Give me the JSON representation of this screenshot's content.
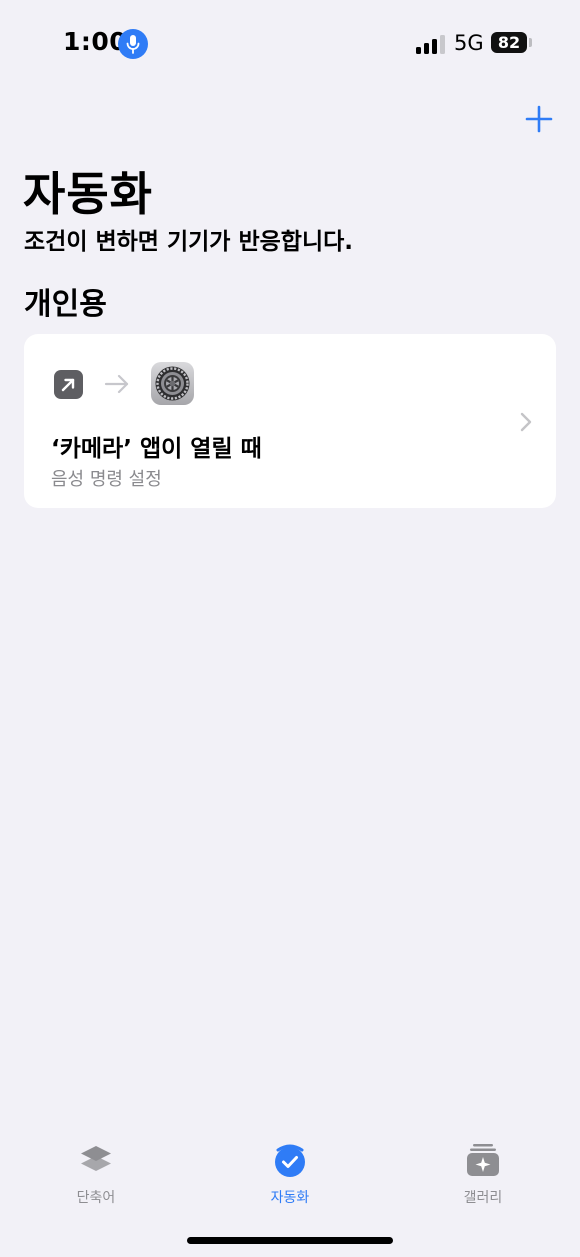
{
  "status_bar": {
    "time": "1:00",
    "network": "5G",
    "battery": "82",
    "mic_icon": "microphone-icon"
  },
  "header": {
    "add_icon": "plus-icon",
    "title": "자동화",
    "subtitle": "조건이 변하면 기기가 반응합니다."
  },
  "section": {
    "title": "개인용"
  },
  "automation": {
    "title": "‘카메라’ 앱이 열릴 때",
    "subtitle": "음성 명령 설정",
    "trigger_icon": "open-app-icon",
    "action_icon": "settings-app-icon"
  },
  "tab_bar": {
    "tabs": [
      {
        "label": "단축어",
        "icon": "shortcuts-layers-icon",
        "active": false
      },
      {
        "label": "자동화",
        "icon": "automation-check-icon",
        "active": true
      },
      {
        "label": "갤러리",
        "icon": "gallery-sparkle-icon",
        "active": false
      }
    ]
  },
  "colors": {
    "accent": "#2F7CF6",
    "background": "#F2F1F7",
    "card": "#FFFFFF",
    "secondary_text": "#8A8A8E"
  }
}
